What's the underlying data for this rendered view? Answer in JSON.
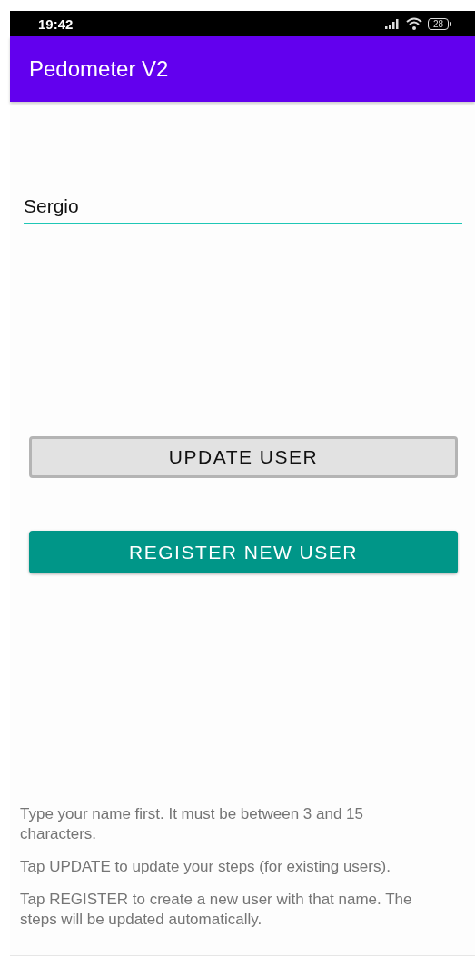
{
  "status_bar": {
    "time": "19:42",
    "battery": "28"
  },
  "app_bar": {
    "title": "Pedometer V2"
  },
  "name_field": {
    "value": "Sergio"
  },
  "buttons": [
    {
      "label": "UPDATE USER",
      "kind": "outlined"
    },
    {
      "label": "REGISTER NEW USER",
      "kind": "filled"
    }
  ],
  "help_texts": [
    "Type your name first. It must be between 3 and 15 characters.",
    "Tap UPDATE to update your steps (for existing users).",
    "Tap REGISTER to create a new user with that name. The steps will be updated automatically."
  ]
}
